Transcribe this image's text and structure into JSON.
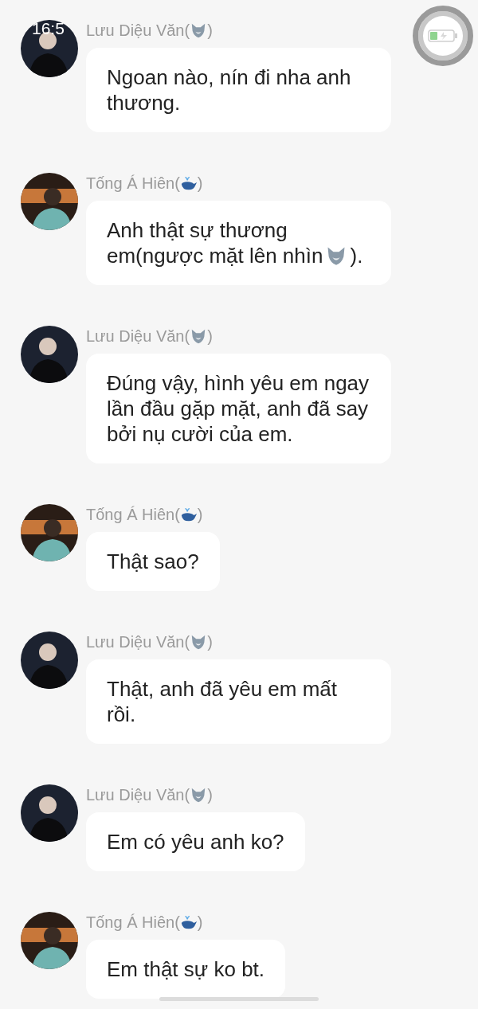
{
  "status_bar": {
    "time": "16:5"
  },
  "messages": [
    {
      "sender": "Lưu Diệu Văn(",
      "sender_close": ")",
      "emblem": {
        "kind": "wolf"
      },
      "avatar": {
        "kind": "dark"
      },
      "parts": [
        {
          "kind": "text",
          "text": "Ngoan nào, nín đi nha anh thương."
        }
      ]
    },
    {
      "sender": "Tống Á Hiên(",
      "sender_close": ")",
      "emblem": {
        "kind": "whale"
      },
      "avatar": {
        "kind": "sunset"
      },
      "parts": [
        {
          "kind": "text",
          "text": "Anh thật sự thương em(ngược mặt lên nhìn"
        },
        {
          "kind": "wolf"
        },
        {
          "kind": "text",
          "text": ")."
        }
      ]
    },
    {
      "sender": "Lưu Diệu Văn(",
      "sender_close": ")",
      "emblem": {
        "kind": "wolf"
      },
      "avatar": {
        "kind": "dark"
      },
      "parts": [
        {
          "kind": "text",
          "text": "Đúng vậy, hình yêu em ngay lần đầu gặp mặt, anh đã say bởi nụ cười của em."
        }
      ]
    },
    {
      "sender": "Tống Á Hiên(",
      "sender_close": ")",
      "emblem": {
        "kind": "whale"
      },
      "avatar": {
        "kind": "sunset"
      },
      "parts": [
        {
          "kind": "text",
          "text": "Thật sao?"
        }
      ]
    },
    {
      "sender": "Lưu Diệu Văn(",
      "sender_close": ")",
      "emblem": {
        "kind": "wolf"
      },
      "avatar": {
        "kind": "dark"
      },
      "parts": [
        {
          "kind": "text",
          "text": "Thật, anh đã yêu em mất rồi."
        }
      ]
    },
    {
      "sender": "Lưu Diệu Văn(",
      "sender_close": ")",
      "emblem": {
        "kind": "wolf"
      },
      "avatar": {
        "kind": "dark"
      },
      "parts": [
        {
          "kind": "text",
          "text": "Em có yêu anh ko?"
        }
      ]
    },
    {
      "sender": "Tống Á Hiên(",
      "sender_close": ")",
      "emblem": {
        "kind": "whale"
      },
      "avatar": {
        "kind": "sunset"
      },
      "parts": [
        {
          "kind": "text",
          "text": "Em thật sự ko bt."
        }
      ]
    }
  ]
}
